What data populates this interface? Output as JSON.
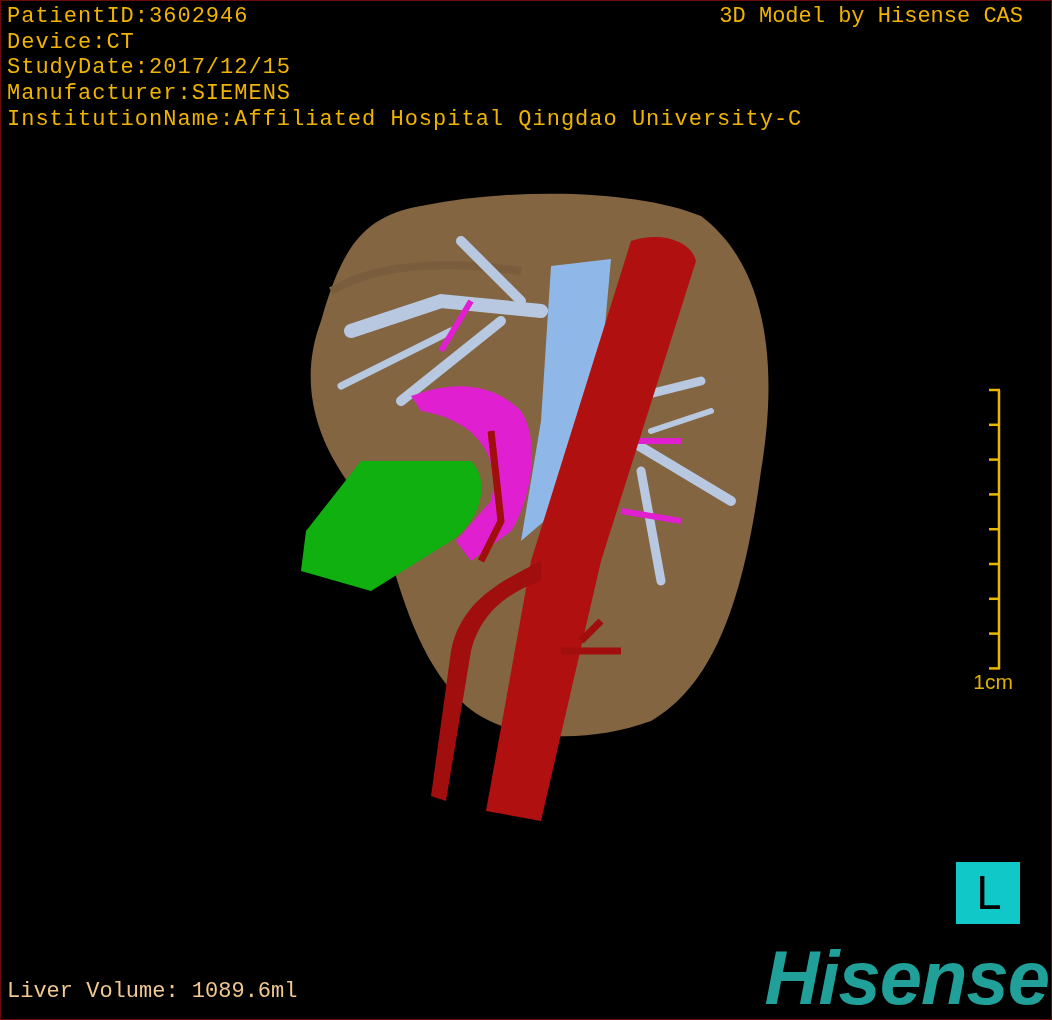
{
  "patient_info": [
    "PatientID:3602946",
    "Device:CT",
    "StudyDate:2017/12/15",
    "Manufacturer:SIEMENS",
    "InstitutionName:Affiliated Hospital Qingdao University-C"
  ],
  "credit": "3D Model by Hisense CAS",
  "scale_bar": {
    "label": "1cm"
  },
  "orientation": "L",
  "liver_volume": "Liver Volume: 1089.6ml",
  "logo": "Hisense"
}
